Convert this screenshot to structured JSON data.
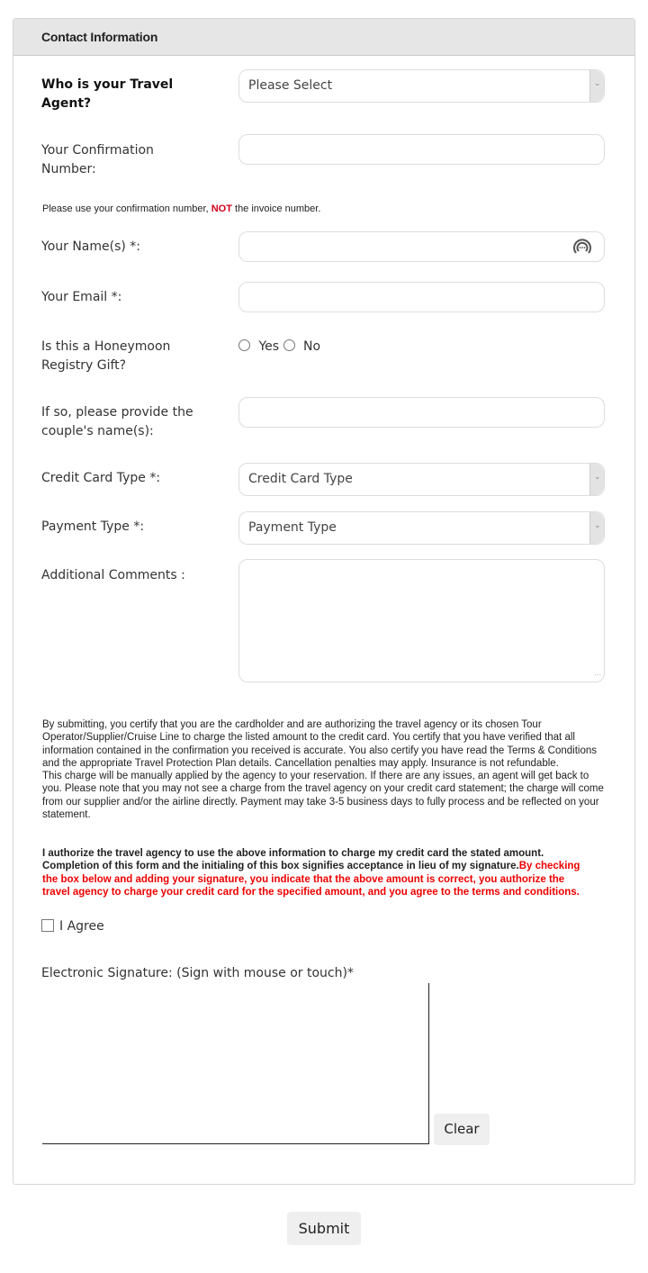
{
  "panel": {
    "title": "Contact Information"
  },
  "fields": {
    "travel_agent": {
      "label": "Who is your Travel Agent?",
      "value": "Please Select"
    },
    "confirmation": {
      "label": "Your Confirmation Number:",
      "value": ""
    },
    "confirmation_note": {
      "prefix": "Please use your confirmation number, ",
      "emphasis": "NOT",
      "suffix": " the invoice number."
    },
    "name": {
      "label": "Your Name(s) *:",
      "value": ""
    },
    "email": {
      "label": "Your Email *:",
      "value": ""
    },
    "honeymoon": {
      "label": "Is this a Honeymoon Registry Gift?",
      "options": [
        "Yes",
        "No"
      ]
    },
    "couple_names": {
      "label": "If so, please provide the couple's name(s):",
      "value": ""
    },
    "credit_card_type": {
      "label": "Credit Card Type *:",
      "value": "Credit Card Type"
    },
    "payment_type": {
      "label": "Payment Type *:",
      "value": "Payment Type"
    },
    "comments": {
      "label": "Additional Comments :",
      "value": ""
    }
  },
  "legal": {
    "paragraph1": "By submitting, you certify that you are the cardholder and are authorizing the travel agency or its chosen Tour Operator/Supplier/Cruise Line to charge the listed amount to the credit card. You certify that you have verified that all information contained in the confirmation you received is accurate. You also certify you have read the Terms & Conditions and the appropriate Travel Protection Plan details. Cancellation penalties may apply. Insurance is not refundable.",
    "paragraph2": "This charge will be manually applied by the agency to your reservation.  If there are any issues, an agent will get back to you.   Please note that you may not see a charge from the travel agency on your credit card statement; the charge will come from our supplier and/or the airline directly. Payment may take 3-5 business days to fully process and be reflected on your statement.",
    "authorize": "I authorize the travel agency to use the above information to charge my credit card the stated amount. Completion of this form and the initialing of this box signifies acceptance in lieu of my signature.",
    "authorize_red": "By checking the box below and adding your signature, you indicate that the above amount is correct, you authorize the travel agency to charge your credit card for the specified amount, and you agree to the terms and conditions."
  },
  "agree_label": "I Agree",
  "signature": {
    "label": "Electronic Signature: (Sign with mouse or touch)*",
    "clear_label": "Clear"
  },
  "submit_label": "Submit",
  "colors": {
    "accent_red": "#e00000",
    "header_bg": "#e6e6e6"
  }
}
